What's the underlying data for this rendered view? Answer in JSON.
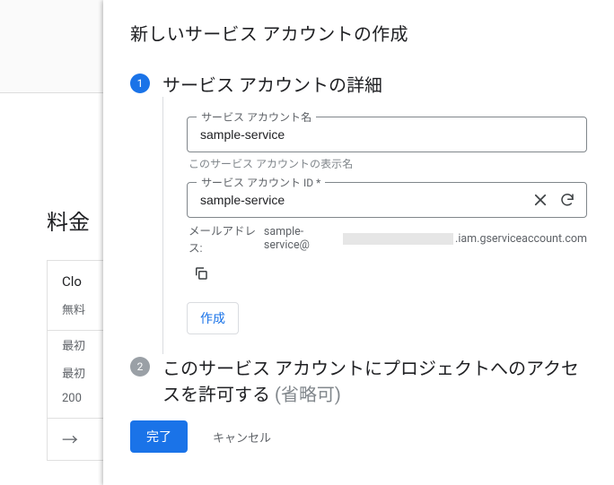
{
  "background": {
    "page_title": "料金",
    "card": {
      "heading": "Clo",
      "line1": "無料",
      "line2": "最初",
      "line3": "最初",
      "line4": "200"
    },
    "arrow_glyph": "→"
  },
  "dialog": {
    "title": "新しいサービス アカウントの作成",
    "step1": {
      "number": "1",
      "title": "サービス アカウントの詳細",
      "name_field": {
        "label": "サービス アカウント名",
        "value": "sample-service",
        "helper": "このサービス アカウントの表示名"
      },
      "id_field": {
        "label": "サービス アカウント ID *",
        "value": "sample-service"
      },
      "email_prefix": "メールアドレス: ",
      "email_local": "sample-service@",
      "email_suffix": ".iam.gserviceaccount.com",
      "create_label": "作成"
    },
    "step2": {
      "number": "2",
      "title_main": "このサービス アカウントにプロジェクトへのアクセスを許可する ",
      "title_opt": "(省略可)"
    },
    "done_label": "完了",
    "cancel_label": "キャンセル"
  }
}
